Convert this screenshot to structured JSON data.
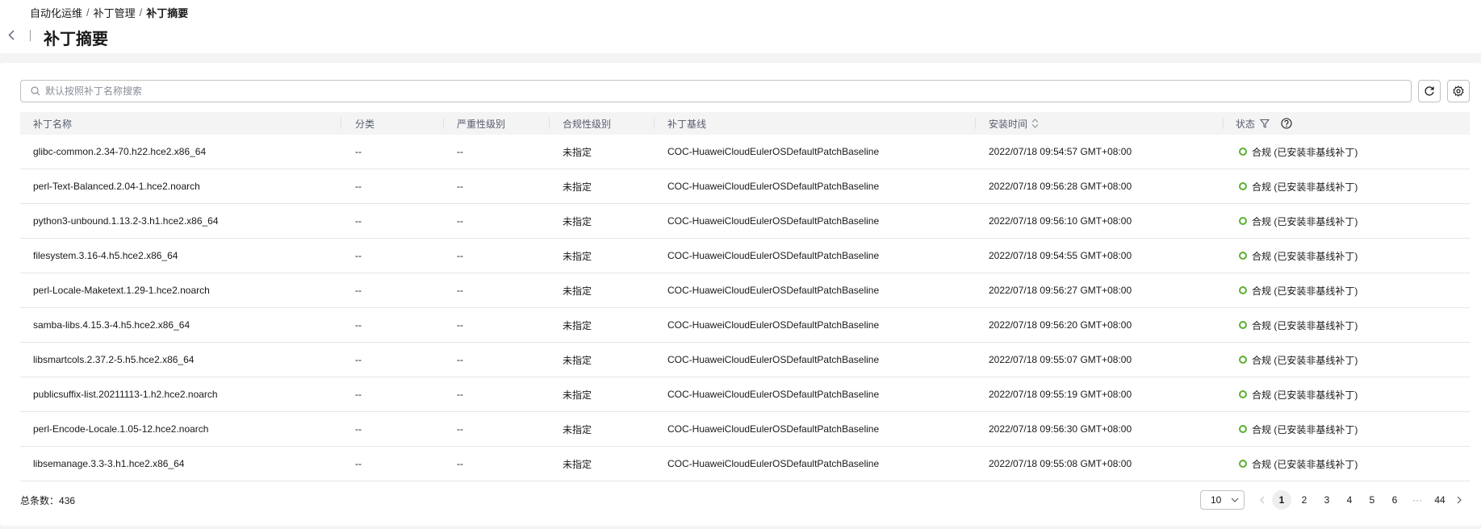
{
  "breadcrumb": {
    "items": [
      "自动化运维",
      "补丁管理",
      "补丁摘要"
    ],
    "separator": "/"
  },
  "page": {
    "title": "补丁摘要"
  },
  "search": {
    "placeholder": "默认按照补丁名称搜索",
    "value": ""
  },
  "table": {
    "columns": {
      "name": "补丁名称",
      "category": "分类",
      "severity": "严重性级别",
      "compliance": "合规性级别",
      "baseline": "补丁基线",
      "install_time": "安装时间",
      "status": "状态"
    },
    "rows": [
      {
        "name": "glibc-common.2.34-70.h22.hce2.x86_64",
        "category": "--",
        "severity": "--",
        "compliance": "未指定",
        "baseline": "COC-HuaweiCloudEulerOSDefaultPatchBaseline",
        "install_time": "2022/07/18 09:54:57 GMT+08:00",
        "status": "合规 (已安装非基线补丁)"
      },
      {
        "name": "perl-Text-Balanced.2.04-1.hce2.noarch",
        "category": "--",
        "severity": "--",
        "compliance": "未指定",
        "baseline": "COC-HuaweiCloudEulerOSDefaultPatchBaseline",
        "install_time": "2022/07/18 09:56:28 GMT+08:00",
        "status": "合规 (已安装非基线补丁)"
      },
      {
        "name": "python3-unbound.1.13.2-3.h1.hce2.x86_64",
        "category": "--",
        "severity": "--",
        "compliance": "未指定",
        "baseline": "COC-HuaweiCloudEulerOSDefaultPatchBaseline",
        "install_time": "2022/07/18 09:56:10 GMT+08:00",
        "status": "合规 (已安装非基线补丁)"
      },
      {
        "name": "filesystem.3.16-4.h5.hce2.x86_64",
        "category": "--",
        "severity": "--",
        "compliance": "未指定",
        "baseline": "COC-HuaweiCloudEulerOSDefaultPatchBaseline",
        "install_time": "2022/07/18 09:54:55 GMT+08:00",
        "status": "合规 (已安装非基线补丁)"
      },
      {
        "name": "perl-Locale-Maketext.1.29-1.hce2.noarch",
        "category": "--",
        "severity": "--",
        "compliance": "未指定",
        "baseline": "COC-HuaweiCloudEulerOSDefaultPatchBaseline",
        "install_time": "2022/07/18 09:56:27 GMT+08:00",
        "status": "合规 (已安装非基线补丁)"
      },
      {
        "name": "samba-libs.4.15.3-4.h5.hce2.x86_64",
        "category": "--",
        "severity": "--",
        "compliance": "未指定",
        "baseline": "COC-HuaweiCloudEulerOSDefaultPatchBaseline",
        "install_time": "2022/07/18 09:56:20 GMT+08:00",
        "status": "合规 (已安装非基线补丁)"
      },
      {
        "name": "libsmartcols.2.37.2-5.h5.hce2.x86_64",
        "category": "--",
        "severity": "--",
        "compliance": "未指定",
        "baseline": "COC-HuaweiCloudEulerOSDefaultPatchBaseline",
        "install_time": "2022/07/18 09:55:07 GMT+08:00",
        "status": "合规 (已安装非基线补丁)"
      },
      {
        "name": "publicsuffix-list.20211113-1.h2.hce2.noarch",
        "category": "--",
        "severity": "--",
        "compliance": "未指定",
        "baseline": "COC-HuaweiCloudEulerOSDefaultPatchBaseline",
        "install_time": "2022/07/18 09:55:19 GMT+08:00",
        "status": "合规 (已安装非基线补丁)"
      },
      {
        "name": "perl-Encode-Locale.1.05-12.hce2.noarch",
        "category": "--",
        "severity": "--",
        "compliance": "未指定",
        "baseline": "COC-HuaweiCloudEulerOSDefaultPatchBaseline",
        "install_time": "2022/07/18 09:56:30 GMT+08:00",
        "status": "合规 (已安装非基线补丁)"
      },
      {
        "name": "libsemanage.3.3-3.h1.hce2.x86_64",
        "category": "--",
        "severity": "--",
        "compliance": "未指定",
        "baseline": "COC-HuaweiCloudEulerOSDefaultPatchBaseline",
        "install_time": "2022/07/18 09:55:08 GMT+08:00",
        "status": "合规 (已安装非基线补丁)"
      }
    ]
  },
  "footer": {
    "total_label": "总条数：",
    "total": "436"
  },
  "pagination": {
    "page_size": "10",
    "pages": [
      "1",
      "2",
      "3",
      "4",
      "5",
      "6"
    ],
    "ellipsis": "···",
    "last_page": "44",
    "current": "1"
  },
  "icons": {
    "back": "chevron-left-icon",
    "search": "search-icon",
    "refresh": "refresh-icon",
    "settings": "gear-icon",
    "sort": "sort-icon",
    "filter": "filter-icon",
    "help": "question-circle-icon",
    "status": "status-circle-icon"
  },
  "colors": {
    "status_success": "#5ab031",
    "header_bg": "#f4f4f5"
  }
}
